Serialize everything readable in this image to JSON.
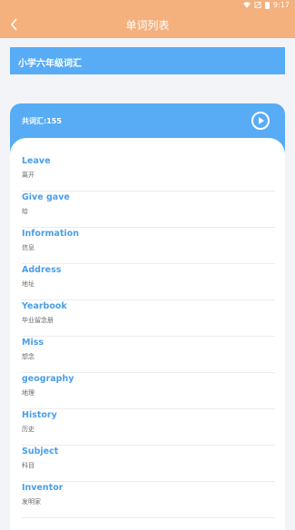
{
  "status": {
    "time": "9:17"
  },
  "header": {
    "title": "单词列表"
  },
  "grade": {
    "title": "小学六年级词汇"
  },
  "list": {
    "count_label": "共词汇:155",
    "words": [
      {
        "en": "Leave",
        "zh": "离开"
      },
      {
        "en": "Give gave",
        "zh": "给"
      },
      {
        "en": "Information",
        "zh": "信息"
      },
      {
        "en": "Address",
        "zh": "地址"
      },
      {
        "en": "Yearbook",
        "zh": "毕业留念册"
      },
      {
        "en": "Miss",
        "zh": "想念"
      },
      {
        "en": "geography",
        "zh": "地理"
      },
      {
        "en": "History",
        "zh": "历史"
      },
      {
        "en": "Subject",
        "zh": "科目"
      },
      {
        "en": "Inventor",
        "zh": "发明家"
      }
    ]
  }
}
